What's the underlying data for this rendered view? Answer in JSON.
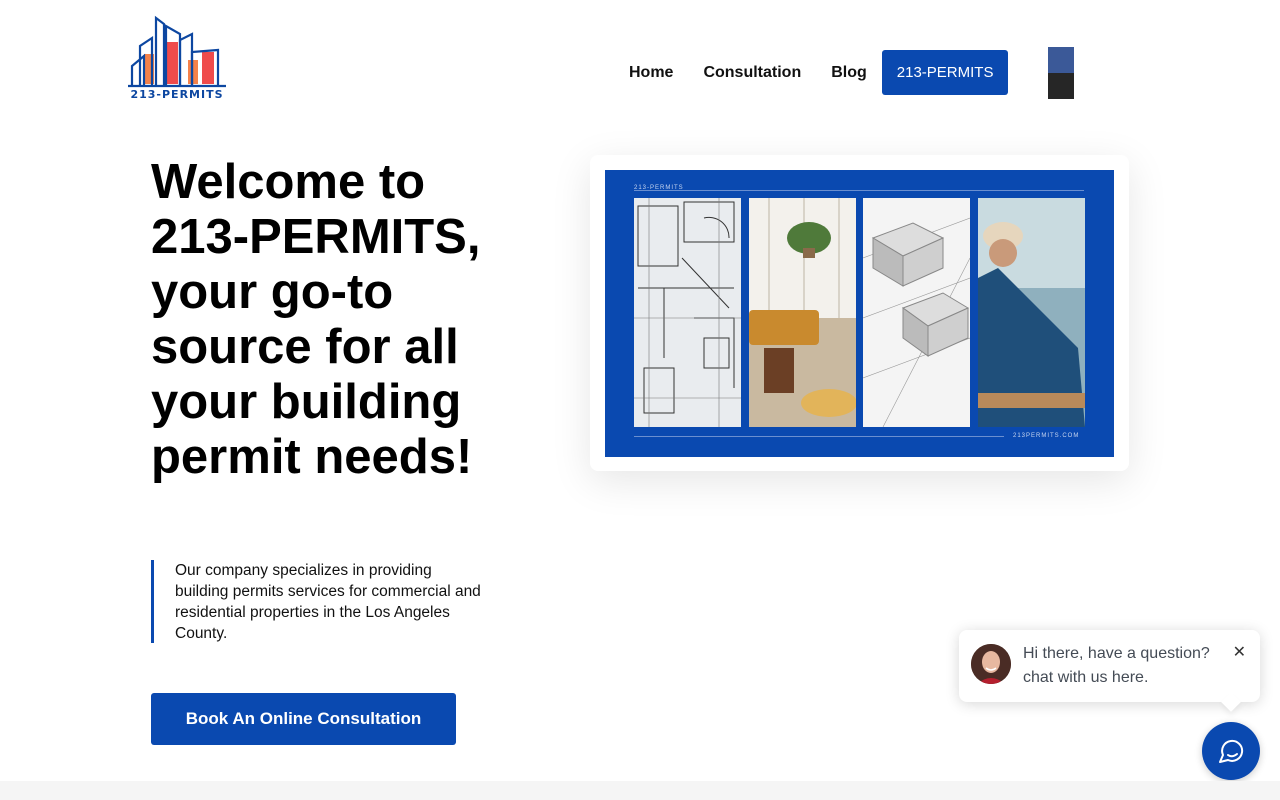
{
  "brand": {
    "logo_text": "213-PERMITS",
    "accent": "#0a49b0",
    "logo_orange": "#f5824a",
    "logo_red": "#ef4b4b"
  },
  "nav": {
    "items": [
      {
        "label": "Home"
      },
      {
        "label": "Consultation"
      },
      {
        "label": "Blog"
      }
    ],
    "cta_label": "213-PERMITS"
  },
  "social": {
    "facebook_icon": "",
    "instagram_icon": ""
  },
  "hero": {
    "title": "Welcome to 213-PERMITS, your go-to source for all your building permit needs!",
    "description": "Our company specializes in providing building permits services for commercial and residential properties in the Los Angeles County.",
    "button_label": "Book An Online Consultation"
  },
  "hero_image": {
    "header_label": "213-PERMITS",
    "footer_label": "213PERMITS.COM"
  },
  "chat": {
    "message": "Hi there, have a question? chat with us here.",
    "close_symbol": "✕"
  }
}
